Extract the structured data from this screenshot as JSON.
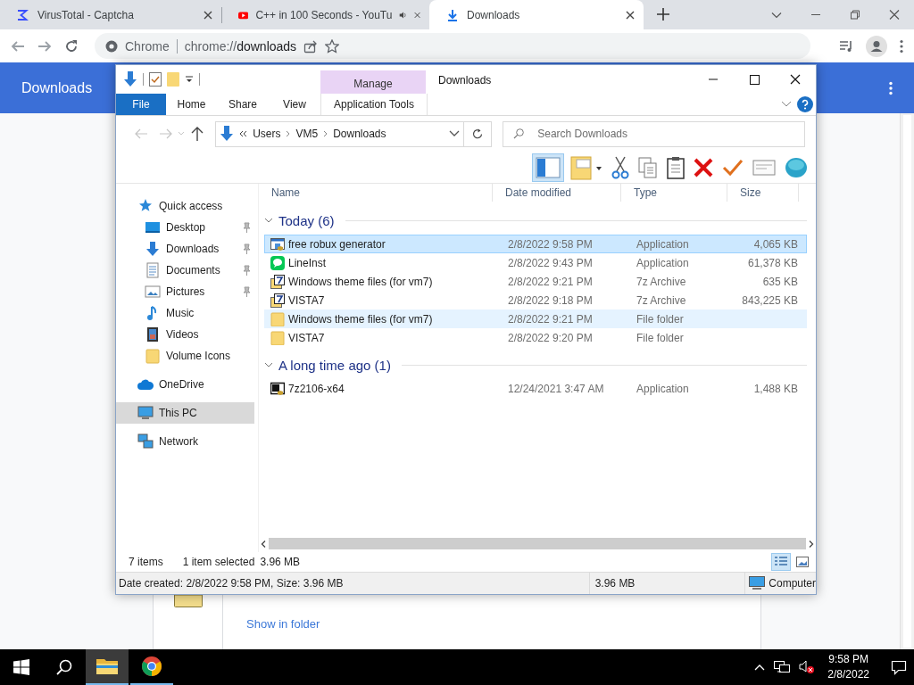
{
  "browser": {
    "tabs": [
      {
        "title": "VirusTotal - Captcha",
        "kind": "virustotal",
        "selected": false,
        "audio": false
      },
      {
        "title": "C++ in 100 Seconds - YouTu",
        "kind": "video",
        "selected": false,
        "audio": true
      },
      {
        "title": "Downloads",
        "kind": "download",
        "selected": true,
        "audio": false
      }
    ],
    "omnibox": {
      "site": "Chrome",
      "url_scheme": "chrome://",
      "url_rest": "downloads"
    }
  },
  "page": {
    "title": "Downloads",
    "card_link": "Show in folder"
  },
  "explorer": {
    "title": "Downloads",
    "context_group": "Manage",
    "ribbon_tabs": [
      {
        "label": "File",
        "kind": "file"
      },
      {
        "label": "Home",
        "kind": "plain"
      },
      {
        "label": "Share",
        "kind": "plain"
      },
      {
        "label": "View",
        "kind": "plain"
      },
      {
        "label": "Application Tools",
        "kind": "context"
      }
    ],
    "path": [
      "Users",
      "VM5",
      "Downloads"
    ],
    "search": {
      "placeholder": "Search Downloads"
    },
    "toolbar": [
      {
        "kind": "preview-pane",
        "selected": true
      },
      {
        "kind": "new-folder",
        "selected": false
      },
      {
        "kind": "cut",
        "selected": false
      },
      {
        "kind": "copy",
        "selected": false
      },
      {
        "kind": "paste",
        "selected": false
      },
      {
        "kind": "delete",
        "selected": false
      },
      {
        "kind": "properties",
        "selected": false
      },
      {
        "kind": "rename",
        "selected": false
      },
      {
        "kind": "globe",
        "selected": false
      }
    ],
    "nav": [
      {
        "label": "Quick access",
        "kind": "star",
        "selected": false,
        "pinned": false,
        "children": [
          {
            "label": "Desktop",
            "kind": "desktop",
            "selected": false,
            "pinned": true
          },
          {
            "label": "Downloads",
            "kind": "download",
            "selected": false,
            "pinned": true
          },
          {
            "label": "Documents",
            "kind": "document",
            "selected": false,
            "pinned": true
          },
          {
            "label": "Pictures",
            "kind": "pictures",
            "selected": false,
            "pinned": true
          },
          {
            "label": "Music",
            "kind": "music",
            "selected": false,
            "pinned": false
          },
          {
            "label": "Videos",
            "kind": "videos",
            "selected": false,
            "pinned": false
          },
          {
            "label": "Volume Icons",
            "kind": "folder",
            "selected": false,
            "pinned": false
          }
        ]
      },
      {
        "label": "OneDrive",
        "kind": "cloud",
        "selected": false,
        "pinned": false
      },
      {
        "label": "This PC",
        "kind": "computer",
        "selected": true,
        "pinned": false
      },
      {
        "label": "Network",
        "kind": "network",
        "selected": false,
        "pinned": false
      }
    ],
    "columns": [
      "Name",
      "Date modified",
      "Type",
      "Size"
    ],
    "groups": [
      {
        "title": "Today (6)",
        "expanded": true,
        "files": [
          {
            "name": "free robux generator",
            "date": "2/8/2022 9:58 PM",
            "type": "Application",
            "size": "4,065 KB",
            "kind": "app",
            "selected": true,
            "hovered": false
          },
          {
            "name": "LineInst",
            "date": "2/8/2022 9:43 PM",
            "type": "Application",
            "size": "61,378 KB",
            "kind": "chat-app",
            "selected": false,
            "hovered": false
          },
          {
            "name": "Windows theme files (for vm7)",
            "date": "2/8/2022 9:21 PM",
            "type": "7z Archive",
            "size": "635 KB",
            "kind": "archive",
            "selected": false,
            "hovered": false
          },
          {
            "name": "VISTA7",
            "date": "2/8/2022 9:18 PM",
            "type": "7z Archive",
            "size": "843,225 KB",
            "kind": "archive",
            "selected": false,
            "hovered": false
          },
          {
            "name": "Windows theme files (for vm7)",
            "date": "2/8/2022 9:21 PM",
            "type": "File folder",
            "kind": "folder",
            "selected": false,
            "hovered": true
          },
          {
            "name": "VISTA7",
            "date": "2/8/2022 9:20 PM",
            "type": "File folder",
            "kind": "folder",
            "selected": false,
            "hovered": false
          }
        ]
      },
      {
        "title": "A long time ago (1)",
        "expanded": true,
        "files": [
          {
            "name": "7z2106-x64",
            "date": "12/24/2021 3:47 AM",
            "type": "Application",
            "size": "1,488 KB",
            "kind": "archive-app",
            "selected": false,
            "hovered": false
          }
        ]
      }
    ],
    "status": {
      "count": "7 items",
      "selection": "1 item selected",
      "selection_size": "3.96 MB",
      "views": [
        {
          "kind": "details",
          "selected": true
        },
        {
          "kind": "large-icons",
          "selected": false
        }
      ]
    },
    "details_bar": {
      "info": "Date created: 2/8/2022 9:58 PM, Size: 3.96 MB",
      "size": "3.96 MB",
      "location": "Computer"
    }
  },
  "taskbar": {
    "apps": [
      {
        "kind": "explorer",
        "active": true
      },
      {
        "kind": "chrome",
        "active": false
      }
    ],
    "time": "9:58 PM",
    "date": "2/8/2022"
  }
}
